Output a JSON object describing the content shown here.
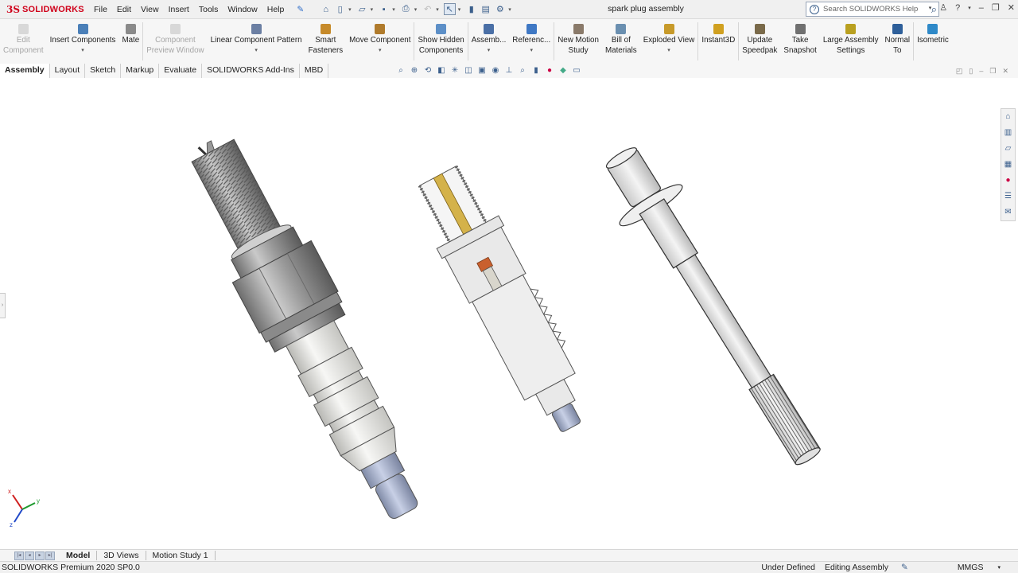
{
  "app": {
    "brand": "SOLIDWORKS",
    "ds": "3S"
  },
  "menu": [
    "File",
    "Edit",
    "View",
    "Insert",
    "Tools",
    "Window",
    "Help"
  ],
  "document_title": "spark plug assembly",
  "search": {
    "placeholder": "Search SOLIDWORKS Help"
  },
  "ribbon": [
    {
      "label": "Edit\nComponent",
      "icon": "edit-component-icon",
      "disabled": true,
      "caret": false
    },
    {
      "label": "Insert Components",
      "icon": "insert-components-icon",
      "disabled": false,
      "caret": true
    },
    {
      "label": "Mate",
      "icon": "mate-icon",
      "disabled": false,
      "caret": false
    },
    {
      "label": "Component\nPreview Window",
      "icon": "preview-window-icon",
      "disabled": true,
      "caret": false
    },
    {
      "label": "Linear Component Pattern",
      "icon": "linear-pattern-icon",
      "disabled": false,
      "caret": true
    },
    {
      "label": "Smart\nFasteners",
      "icon": "smart-fasteners-icon",
      "disabled": false,
      "caret": false
    },
    {
      "label": "Move Component",
      "icon": "move-component-icon",
      "disabled": false,
      "caret": true
    },
    {
      "label": "Show Hidden\nComponents",
      "icon": "show-hidden-icon",
      "disabled": false,
      "caret": false
    },
    {
      "label": "Assemb...",
      "icon": "assembly-features-icon",
      "disabled": false,
      "caret": true
    },
    {
      "label": "Referenc...",
      "icon": "reference-geometry-icon",
      "disabled": false,
      "caret": true
    },
    {
      "label": "New Motion\nStudy",
      "icon": "motion-study-icon",
      "disabled": false,
      "caret": false
    },
    {
      "label": "Bill of\nMaterials",
      "icon": "bom-icon",
      "disabled": false,
      "caret": false
    },
    {
      "label": "Exploded View",
      "icon": "exploded-view-icon",
      "disabled": false,
      "caret": true
    },
    {
      "label": "Instant3D",
      "icon": "instant3d-icon",
      "disabled": false,
      "caret": false
    },
    {
      "label": "Update\nSpeedpak",
      "icon": "speedpak-icon",
      "disabled": false,
      "caret": false
    },
    {
      "label": "Take\nSnapshot",
      "icon": "snapshot-icon",
      "disabled": false,
      "caret": false
    },
    {
      "label": "Large Assembly\nSettings",
      "icon": "large-assembly-icon",
      "disabled": false,
      "caret": false
    },
    {
      "label": "Normal\nTo",
      "icon": "normal-to-icon",
      "disabled": false,
      "caret": false
    },
    {
      "label": "Isometric",
      "icon": "isometric-icon",
      "disabled": false,
      "caret": false
    }
  ],
  "command_tabs": [
    "Assembly",
    "Layout",
    "Sketch",
    "Markup",
    "Evaluate",
    "SOLIDWORKS Add-Ins",
    "MBD"
  ],
  "active_command_tab": "Assembly",
  "bottom_tabs": [
    "Model",
    "3D Views",
    "Motion Study 1"
  ],
  "active_bottom_tab": "Model",
  "status": {
    "product": "SOLIDWORKS Premium 2020 SP0.0",
    "definition": "Under Defined",
    "mode": "Editing Assembly",
    "units": "MMGS"
  },
  "triad": {
    "x": "x",
    "y": "y",
    "z": "z"
  },
  "colors": {
    "brand_red": "#d0021b",
    "accent_blue": "#3b5f8c"
  }
}
